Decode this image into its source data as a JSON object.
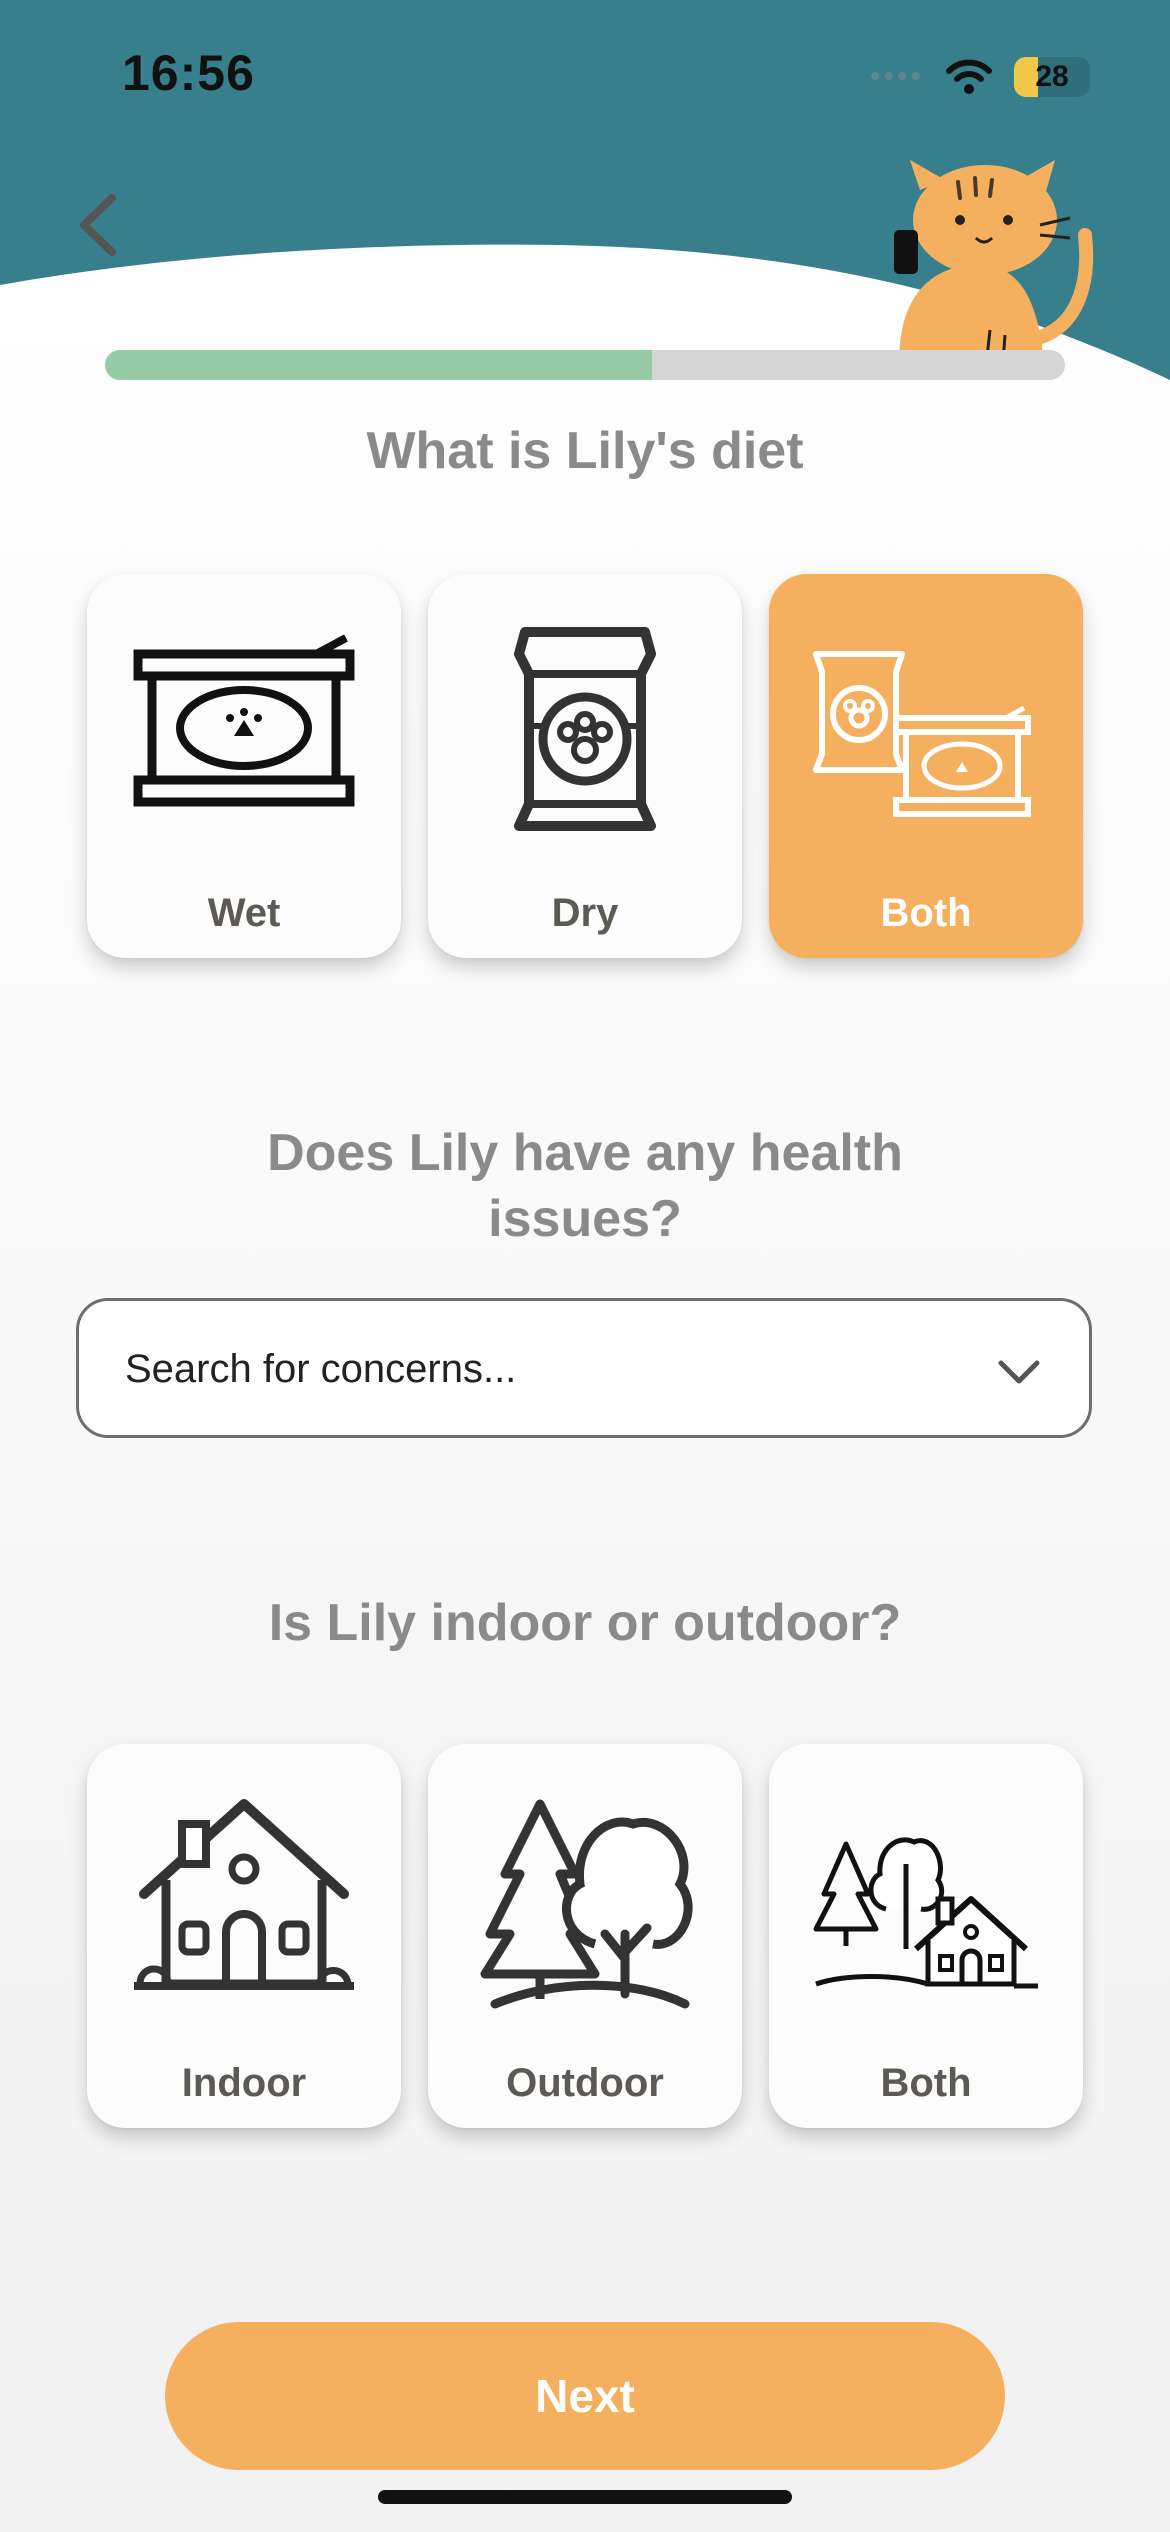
{
  "status_bar": {
    "time": "16:56",
    "battery": "28",
    "icons": [
      "cellular-icon",
      "wifi-icon",
      "battery-icon"
    ]
  },
  "header": {
    "back_icon": "chevron-left-icon",
    "mascot": "cat-illustration",
    "colors": {
      "teal": "#387f8e"
    }
  },
  "progress": {
    "value": 0.57,
    "color": "#96cba8"
  },
  "diet": {
    "question": "What is Lily's diet",
    "options": [
      {
        "label": "Wet",
        "icon": "wet-food-can-icon",
        "selected": false
      },
      {
        "label": "Dry",
        "icon": "dry-food-bag-icon",
        "selected": false
      },
      {
        "label": "Both",
        "icon": "wet-and-dry-food-icon",
        "selected": true
      }
    ]
  },
  "health": {
    "question": "Does Lily have any health issues?",
    "search_placeholder": "Search for concerns...",
    "dropdown_icon": "chevron-down-icon"
  },
  "environment": {
    "question": "Is Lily indoor or outdoor?",
    "options": [
      {
        "label": "Indoor",
        "icon": "house-icon",
        "selected": false
      },
      {
        "label": "Outdoor",
        "icon": "trees-icon",
        "selected": false
      },
      {
        "label": "Both",
        "icon": "house-and-trees-icon",
        "selected": false
      }
    ]
  },
  "next_button": {
    "label": "Next"
  },
  "colors": {
    "accent": "#f4b05f",
    "selected_text": "#ffffff"
  }
}
